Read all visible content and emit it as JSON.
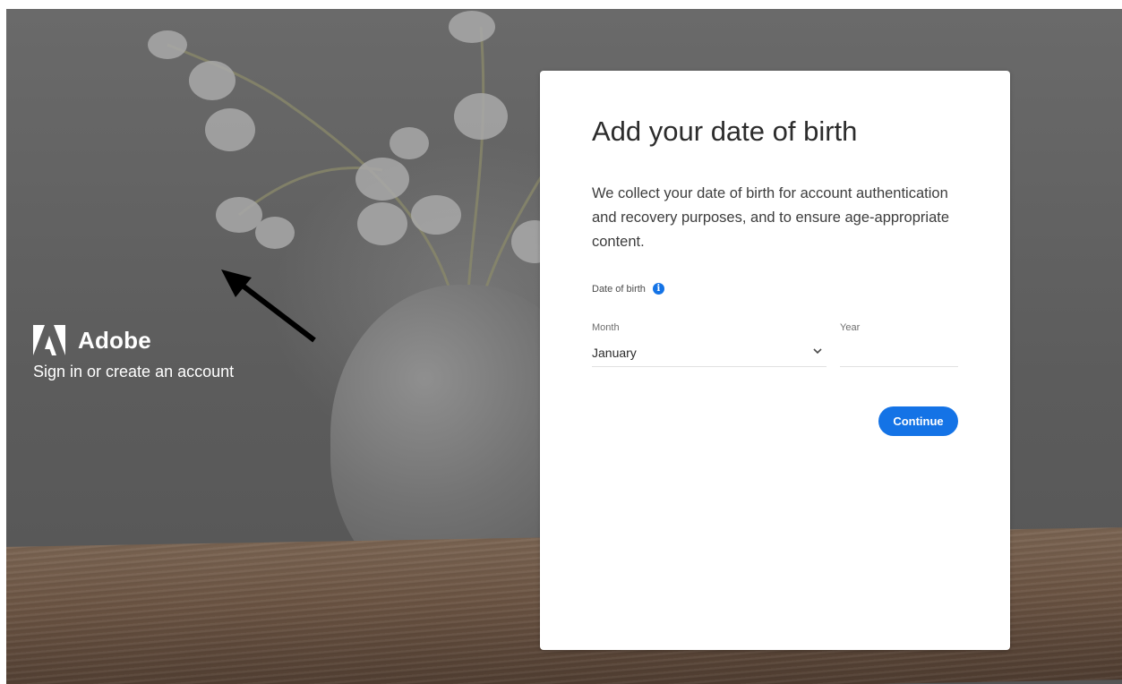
{
  "brand": {
    "name": "Adobe",
    "tagline": "Sign in or create an account",
    "logo_icon": "adobe-logo-icon"
  },
  "card": {
    "title": "Add your date of birth",
    "description": "We collect your date of birth for account authentication and recovery purposes, and to ensure age-appropriate content.",
    "dob_label": "Date of birth",
    "info_icon": "info-icon",
    "month_label": "Month",
    "month_value": "January",
    "year_label": "Year",
    "year_value": "",
    "continue_label": "Continue"
  },
  "colors": {
    "accent": "#1473e6",
    "title_text": "#2c2c2c",
    "background_overlay": "#5e5e5e"
  }
}
